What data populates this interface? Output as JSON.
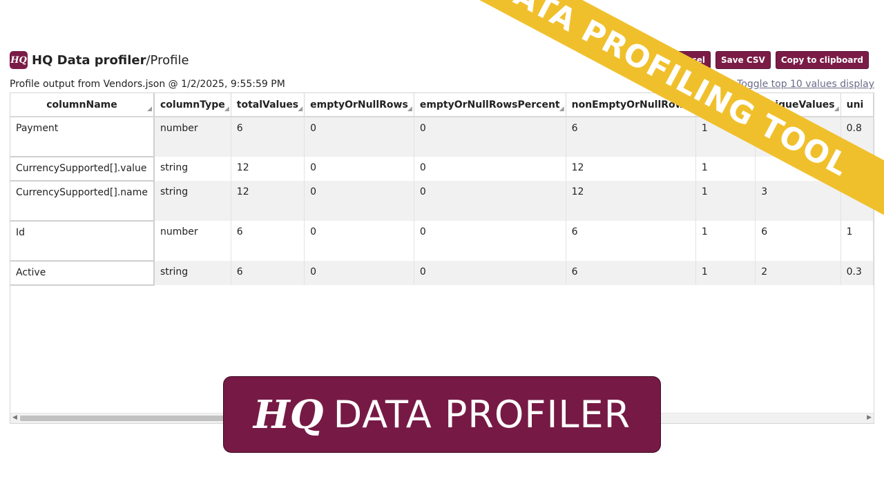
{
  "header": {
    "logo_text": "HQ",
    "app_title": "HQ Data profiler",
    "separator": "/",
    "breadcrumb": "Profile"
  },
  "toolbar": {
    "save_excel": "Save Excel",
    "save_csv": "Save CSV",
    "copy_clipboard": "Copy to clipboard"
  },
  "subtitle": "Profile output from Vendors.json @ 1/2/2025, 9:55:59 PM",
  "toggle_link": "Toggle top 10 values display",
  "table": {
    "columns": [
      "columnName",
      "columnType",
      "totalValues",
      "emptyOrNullRows",
      "emptyOrNullRowsPercent",
      "nonEmptyOrNullRows",
      "",
      "uniqueValues",
      "uni"
    ],
    "rows": [
      [
        "Payment",
        "number",
        "6",
        "0",
        "0",
        "6",
        "1",
        "",
        "0.8"
      ],
      [
        "CurrencySupported[].value",
        "string",
        "12",
        "0",
        "0",
        "12",
        "1",
        "",
        ""
      ],
      [
        "CurrencySupported[].name",
        "string",
        "12",
        "0",
        "0",
        "12",
        "1",
        "3",
        ""
      ],
      [
        "Id",
        "number",
        "6",
        "0",
        "0",
        "6",
        "1",
        "6",
        "1"
      ],
      [
        "Active",
        "string",
        "6",
        "0",
        "0",
        "6",
        "1",
        "2",
        "0.3"
      ]
    ]
  },
  "banner": {
    "text": "DATA PROFILING TOOL",
    "color": "#f0c02c"
  },
  "overlay": {
    "logo": "HQ",
    "text": "DATA PROFILER",
    "color": "#761a45"
  },
  "colors": {
    "brand": "#7b1c47",
    "row_alt": "#f1f1f1"
  }
}
